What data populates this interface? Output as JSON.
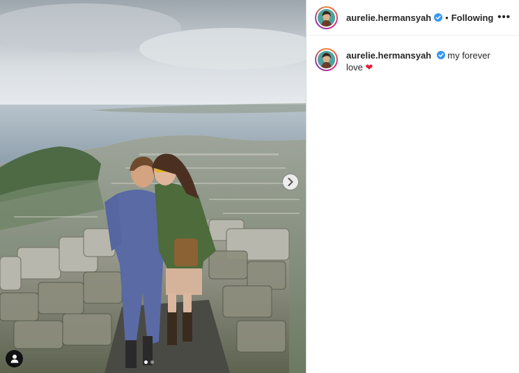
{
  "post": {
    "username": "aurelie.hermansyah",
    "separator": "•",
    "follow_status": "Following",
    "more_label": "•••",
    "caption_text": "my forever love",
    "caption_emoji": "❤"
  },
  "carousel": {
    "total_slides": 2,
    "active_slide": 1
  },
  "colors": {
    "verified_blue": "#3897f0",
    "heart_red": "#e01e37",
    "text": "#262626"
  },
  "icons": {
    "next": "chevron-right-icon",
    "tag": "user-tag-icon",
    "verified": "verified-badge-icon",
    "more": "more-options-icon"
  }
}
